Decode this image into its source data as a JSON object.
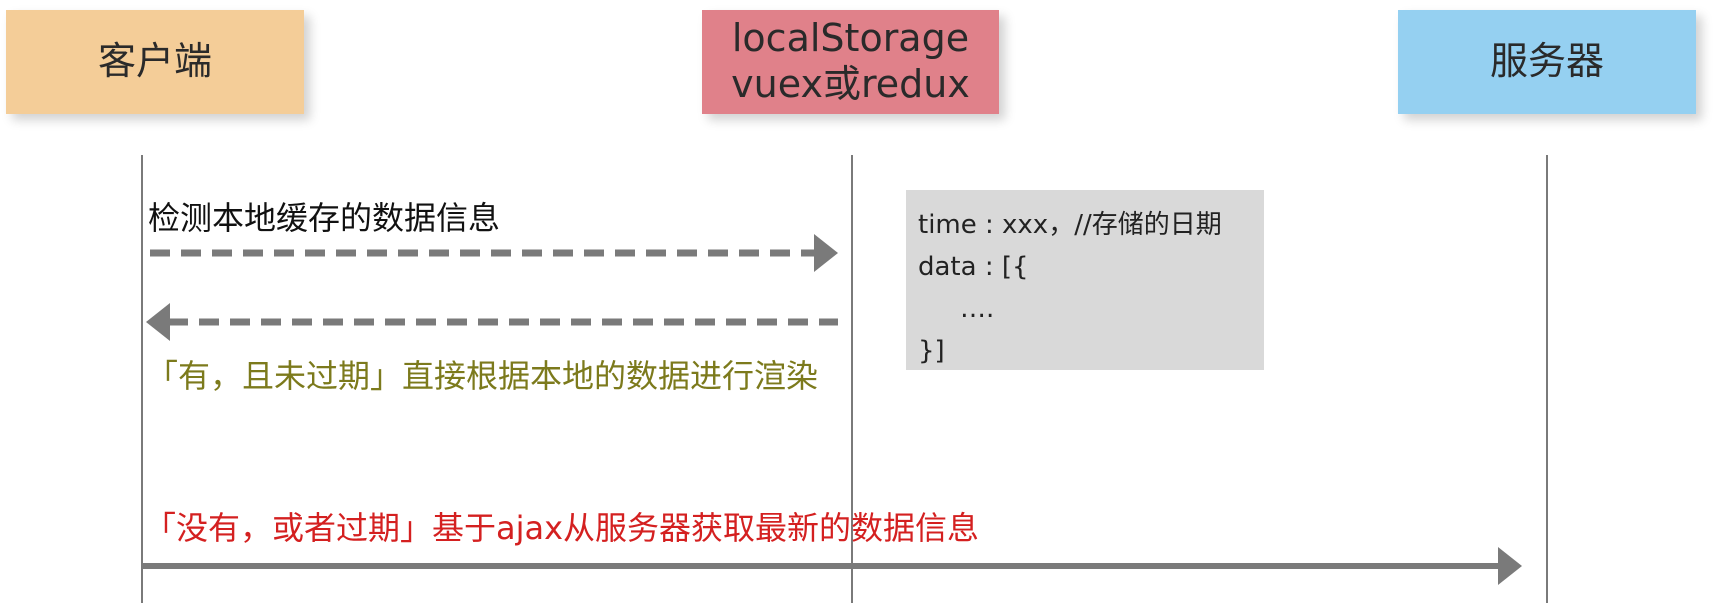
{
  "actors": {
    "client": {
      "label": "客户端",
      "color": "#f4cd98"
    },
    "storage": {
      "line1": "localStorage",
      "line2": "vuex或redux",
      "color": "#e0818a"
    },
    "server": {
      "label": "服务器",
      "color": "#95d0f1"
    }
  },
  "messages": {
    "check_local": "检测本地缓存的数据信息",
    "valid_render": "「有，且未过期」直接根据本地的数据进行渲染",
    "fetch_server": "「没有，或者过期」基于ajax从服务器获取最新的数据信息"
  },
  "note": {
    "line1": "time : xxx，//存储的日期",
    "line2": "data : [{",
    "line3": "….",
    "line4": "}]"
  },
  "colors": {
    "arrow": "#7a7a7a",
    "valid_text": "#7c7a1c",
    "fetch_text": "#d42020"
  }
}
